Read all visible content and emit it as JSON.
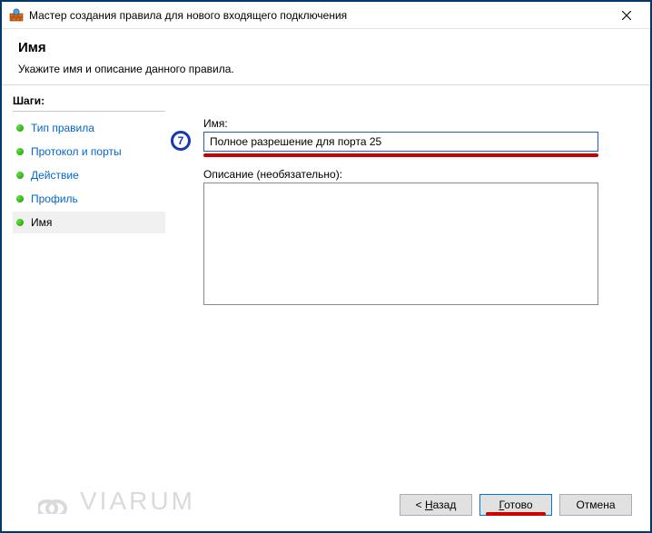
{
  "window": {
    "title": "Мастер создания правила для нового входящего подключения"
  },
  "header": {
    "title": "Имя",
    "subtitle": "Укажите имя и описание данного правила."
  },
  "steps": {
    "title": "Шаги:",
    "items": [
      {
        "label": "Тип правила"
      },
      {
        "label": "Протокол и порты"
      },
      {
        "label": "Действие"
      },
      {
        "label": "Профиль"
      },
      {
        "label": "Имя"
      }
    ],
    "current_index": 4
  },
  "annotation": {
    "badge": "7"
  },
  "form": {
    "name_label": "Имя:",
    "name_value": "Полное разрешение для порта 25",
    "desc_label": "Описание (необязательно):",
    "desc_value": ""
  },
  "buttons": {
    "back": "< Назад",
    "finish": "Готово",
    "cancel": "Отмена"
  },
  "watermark": "VIARUM"
}
